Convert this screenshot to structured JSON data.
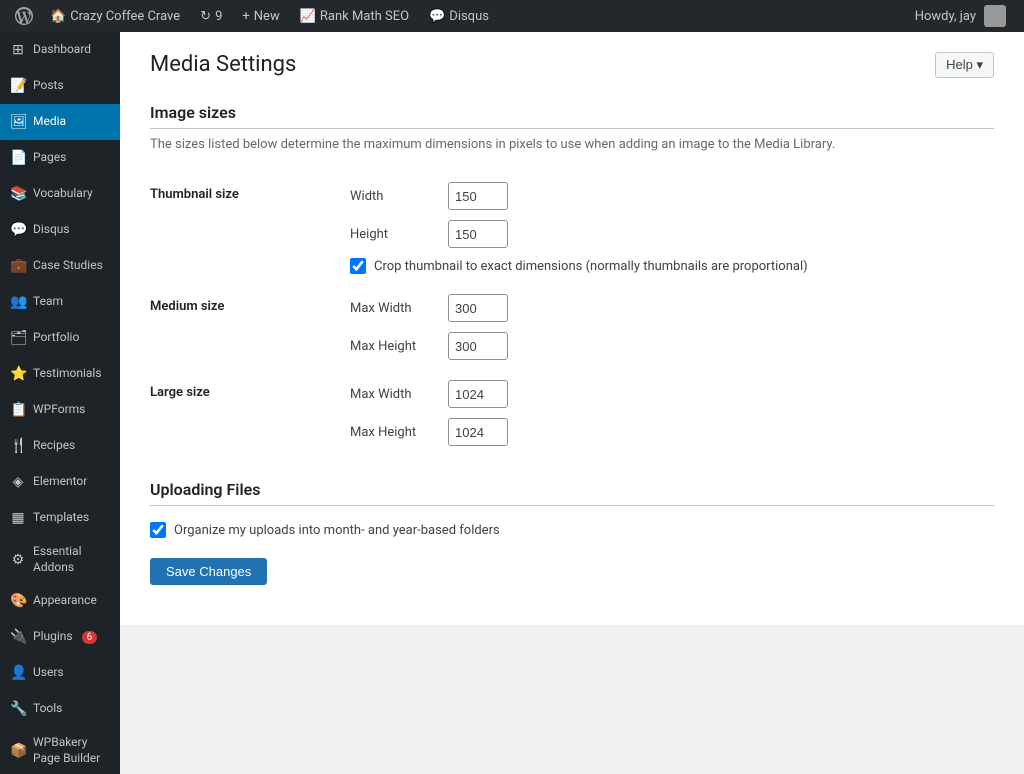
{
  "adminbar": {
    "items": [
      {
        "id": "wp-logo",
        "icon": "⓪",
        "label": ""
      },
      {
        "id": "site-name",
        "icon": "🏠",
        "label": "Crazy Coffee Crave"
      },
      {
        "id": "updates",
        "icon": "↻",
        "label": "9",
        "badge": "9"
      },
      {
        "id": "new",
        "icon": "+",
        "label": "New"
      },
      {
        "id": "rankmath",
        "icon": "📈",
        "label": "Rank Math SEO"
      },
      {
        "id": "disqus",
        "icon": "💬",
        "label": "Disqus"
      }
    ],
    "right": {
      "howdy": "Howdy, jay"
    },
    "help_label": "Help ▾"
  },
  "sidebar": {
    "items": [
      {
        "id": "dashboard",
        "icon": "⊞",
        "label": "Dashboard"
      },
      {
        "id": "posts",
        "icon": "📝",
        "label": "Posts"
      },
      {
        "id": "media",
        "icon": "🖼",
        "label": "Media"
      },
      {
        "id": "pages",
        "icon": "📄",
        "label": "Pages"
      },
      {
        "id": "vocabulary",
        "icon": "📚",
        "label": "Vocabulary"
      },
      {
        "id": "disqus",
        "icon": "💬",
        "label": "Disqus"
      },
      {
        "id": "case-studies",
        "icon": "💼",
        "label": "Case Studies"
      },
      {
        "id": "team",
        "icon": "👥",
        "label": "Team"
      },
      {
        "id": "portfolio",
        "icon": "🗂",
        "label": "Portfolio"
      },
      {
        "id": "testimonials",
        "icon": "⭐",
        "label": "Testimonials"
      },
      {
        "id": "wpforms",
        "icon": "📋",
        "label": "WPForms"
      },
      {
        "id": "recipes",
        "icon": "🍴",
        "label": "Recipes"
      },
      {
        "id": "elementor",
        "icon": "◈",
        "label": "Elementor"
      },
      {
        "id": "templates",
        "icon": "▦",
        "label": "Templates"
      },
      {
        "id": "essential-addons",
        "icon": "⚙",
        "label": "Essential Addons"
      },
      {
        "id": "appearance",
        "icon": "🎨",
        "label": "Appearance"
      },
      {
        "id": "plugins",
        "icon": "🔌",
        "label": "Plugins",
        "badge": "6"
      },
      {
        "id": "users",
        "icon": "👤",
        "label": "Users"
      },
      {
        "id": "tools",
        "icon": "🔧",
        "label": "Tools"
      },
      {
        "id": "wpbakery",
        "icon": "📦",
        "label": "WPBakery Page Builder"
      }
    ]
  },
  "page": {
    "title": "Media Settings",
    "help_button": "Help",
    "image_sizes": {
      "section_title": "Image sizes",
      "description": "The sizes listed below determine the maximum dimensions in pixels to use when adding an image to the Media Library.",
      "thumbnail": {
        "label": "Thumbnail size",
        "width_label": "Width",
        "width_value": "150",
        "height_label": "Height",
        "height_value": "150",
        "crop_label": "Crop thumbnail to exact dimensions (normally thumbnails are proportional)",
        "crop_checked": true
      },
      "medium": {
        "label": "Medium size",
        "max_width_label": "Max Width",
        "max_width_value": "300",
        "max_height_label": "Max Height",
        "max_height_value": "300"
      },
      "large": {
        "label": "Large size",
        "max_width_label": "Max Width",
        "max_width_value": "1024",
        "max_height_label": "Max Height",
        "max_height_value": "1024"
      }
    },
    "uploading_files": {
      "section_title": "Uploading Files",
      "organize_label": "Organize my uploads into month- and year-based folders",
      "organize_checked": true
    },
    "save_button": "Save Changes"
  }
}
